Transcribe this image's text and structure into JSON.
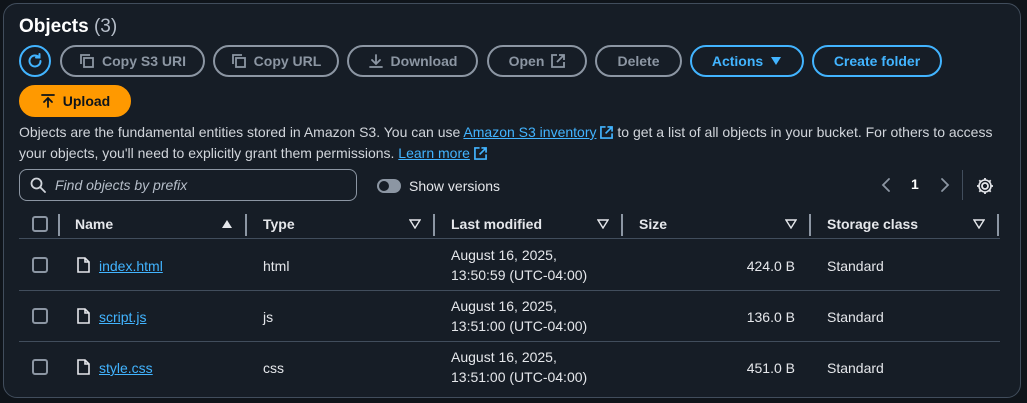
{
  "header": {
    "title": "Objects",
    "count": "(3)"
  },
  "toolbar": {
    "copy_s3_uri": "Copy S3 URI",
    "copy_url": "Copy URL",
    "download": "Download",
    "open": "Open",
    "delete": "Delete",
    "actions": "Actions",
    "create_folder": "Create folder",
    "upload": "Upload"
  },
  "description": {
    "part1": "Objects are the fundamental entities stored in Amazon S3. You can use ",
    "inventory_link": "Amazon S3 inventory",
    "part2": " to get a list of all objects in your bucket. For others to access your objects, you'll need to explicitly grant them permissions. ",
    "learn_more": "Learn more"
  },
  "search": {
    "placeholder": "Find objects by prefix"
  },
  "show_versions": {
    "label": "Show versions",
    "enabled": false
  },
  "pagination": {
    "current_page": "1"
  },
  "table": {
    "columns": [
      "Name",
      "Type",
      "Last modified",
      "Size",
      "Storage class"
    ],
    "rows": [
      {
        "name": "index.html",
        "type": "html",
        "modified_date": "August 16, 2025,",
        "modified_time": "13:50:59 (UTC-04:00)",
        "size": "424.0 B",
        "storage_class": "Standard"
      },
      {
        "name": "script.js",
        "type": "js",
        "modified_date": "August 16, 2025,",
        "modified_time": "13:51:00 (UTC-04:00)",
        "size": "136.0 B",
        "storage_class": "Standard"
      },
      {
        "name": "style.css",
        "type": "css",
        "modified_date": "August 16, 2025,",
        "modified_time": "13:51:00 (UTC-04:00)",
        "size": "451.0 B",
        "storage_class": "Standard"
      }
    ]
  },
  "colors": {
    "accent": "#42b4ff",
    "upload": "#ff9900",
    "background": "#161d26"
  },
  "icons": [
    "refresh-icon",
    "copy-icon",
    "download-icon",
    "external-link-icon",
    "caret-down-icon",
    "upload-icon",
    "search-icon",
    "sort-icon",
    "file-icon",
    "chevron-left-icon",
    "chevron-right-icon",
    "gear-icon"
  ]
}
